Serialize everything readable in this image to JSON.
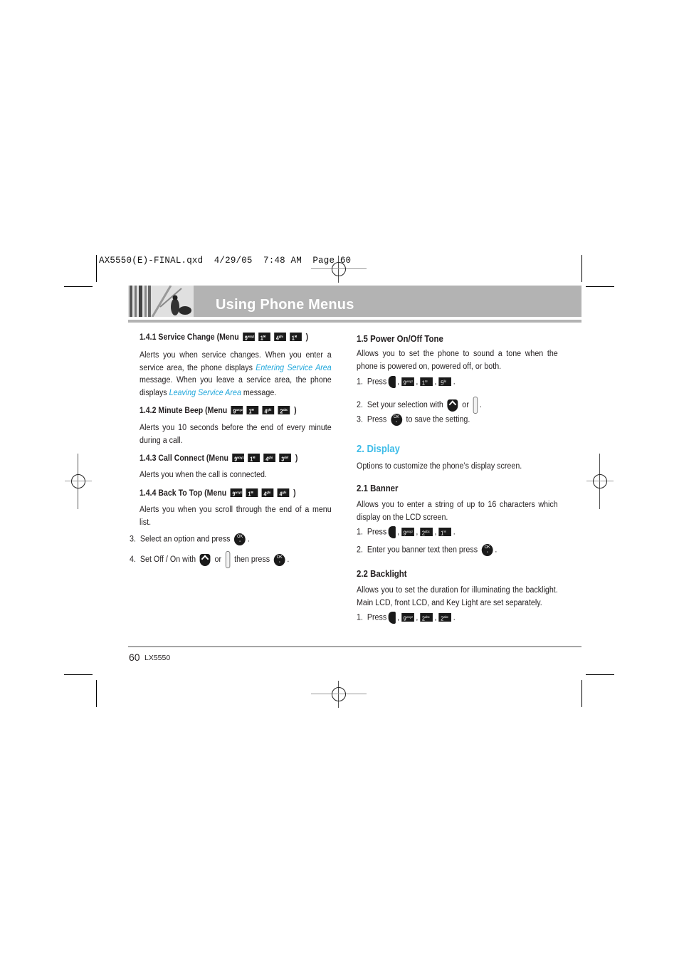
{
  "slug_line": "AX5550(E)-FINAL.qxd  4/29/05  7:48 AM  Page 60",
  "header": {
    "title": "Using Phone Menus",
    "bar_color": "#b3b3b3"
  },
  "left_column": {
    "s141": {
      "heading": "1.4.1 Service Change (Menu",
      "keys": [
        "9",
        "1",
        "4",
        "1"
      ],
      "close": ")",
      "body_1": "Alerts you when service changes. When you enter a service area, the phone displays",
      "link_1": "Entering Service Area",
      "body_2": "message. When you leave a service area, the phone displays",
      "link_2": "Leaving Service Area",
      "body_3": "message."
    },
    "s142": {
      "heading": "1.4.2 Minute Beep (Menu",
      "keys": [
        "9",
        "1",
        "4",
        "2"
      ],
      "close": ")",
      "body": "Alerts you 10 seconds before the end of every minute during a call."
    },
    "s143": {
      "heading": "1.4.3 Call Connect (Menu",
      "keys": [
        "9",
        "1",
        "4",
        "3"
      ],
      "close": ")",
      "body": "Alerts you when the call is connected."
    },
    "s144": {
      "heading": "1.4.4 Back To Top (Menu",
      "keys": [
        "9",
        "1",
        "4",
        "4"
      ],
      "close": ")",
      "body": "Alerts you when you scroll through the end of a menu list."
    },
    "step3": {
      "num": "3.",
      "text": "Select an option and press",
      "end": "."
    },
    "step4": {
      "num": "4.",
      "text": "Set Off / On with",
      "or": "or",
      "then": "then press",
      "end": "."
    }
  },
  "right_column": {
    "s15": {
      "heading": "1.5 Power On/Off Tone",
      "body": "Allows you to set the phone to sound a tone when the phone is powered on, powered off, or both.",
      "step1": {
        "num": "1.",
        "text": "Press",
        "keys": [
          "9",
          "1",
          "5"
        ]
      },
      "step2": {
        "num": "2.",
        "text": "Set your selection with",
        "or": "or",
        "end": "."
      },
      "step3": {
        "num": "3.",
        "text": "Press",
        "after": "to save the setting."
      }
    },
    "s2": {
      "heading": "2. Display",
      "body": "Options to customize the phone’s display screen."
    },
    "s21": {
      "heading": "2.1 Banner",
      "body": "Allows you to enter a string of up to 16 characters which display on the LCD screen.",
      "step1": {
        "num": "1.",
        "text": "Press",
        "keys": [
          "9",
          "2",
          "1"
        ]
      },
      "step2": {
        "num": "2.",
        "text": "Enter you banner text then press",
        "end": "."
      }
    },
    "s22": {
      "heading": "2.2 Backlight",
      "body": "Allows you to set the duration for illuminating the backlight. Main LCD, front LCD, and Key Light are set separately.",
      "step1": {
        "num": "1.",
        "text": "Press",
        "keys": [
          "9",
          "2",
          "2"
        ]
      }
    }
  },
  "footer": {
    "page_number": "60",
    "model": "LX5550"
  },
  "colors": {
    "accent": "#3dbce8",
    "link": "#1fa7dc",
    "text": "#231f20"
  }
}
